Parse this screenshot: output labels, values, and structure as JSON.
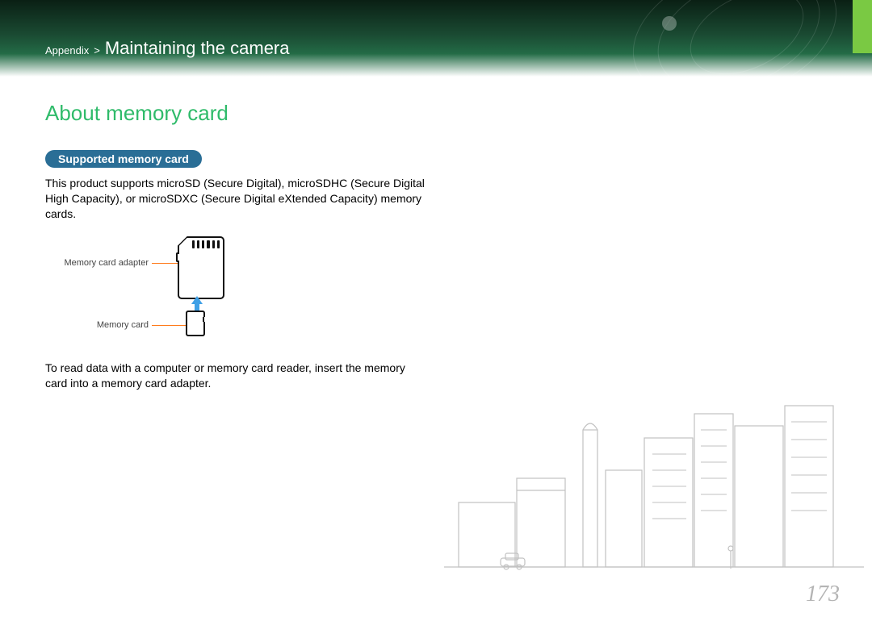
{
  "breadcrumb": {
    "parent": "Appendix",
    "separator": ">",
    "current": "Maintaining the camera"
  },
  "section": {
    "title": "About memory card",
    "subheading_pill": "Supported memory card",
    "paragraph1": "This product supports microSD (Secure Digital), microSDHC (Secure Digital High Capacity), or microSDXC (Secure Digital eXtended Capacity) memory cards.",
    "paragraph2": "To read data with a computer or memory card reader, insert the memory card into a memory card adapter."
  },
  "diagram": {
    "adapter_label": "Memory card adapter",
    "card_label": "Memory card"
  },
  "page_number": "173"
}
